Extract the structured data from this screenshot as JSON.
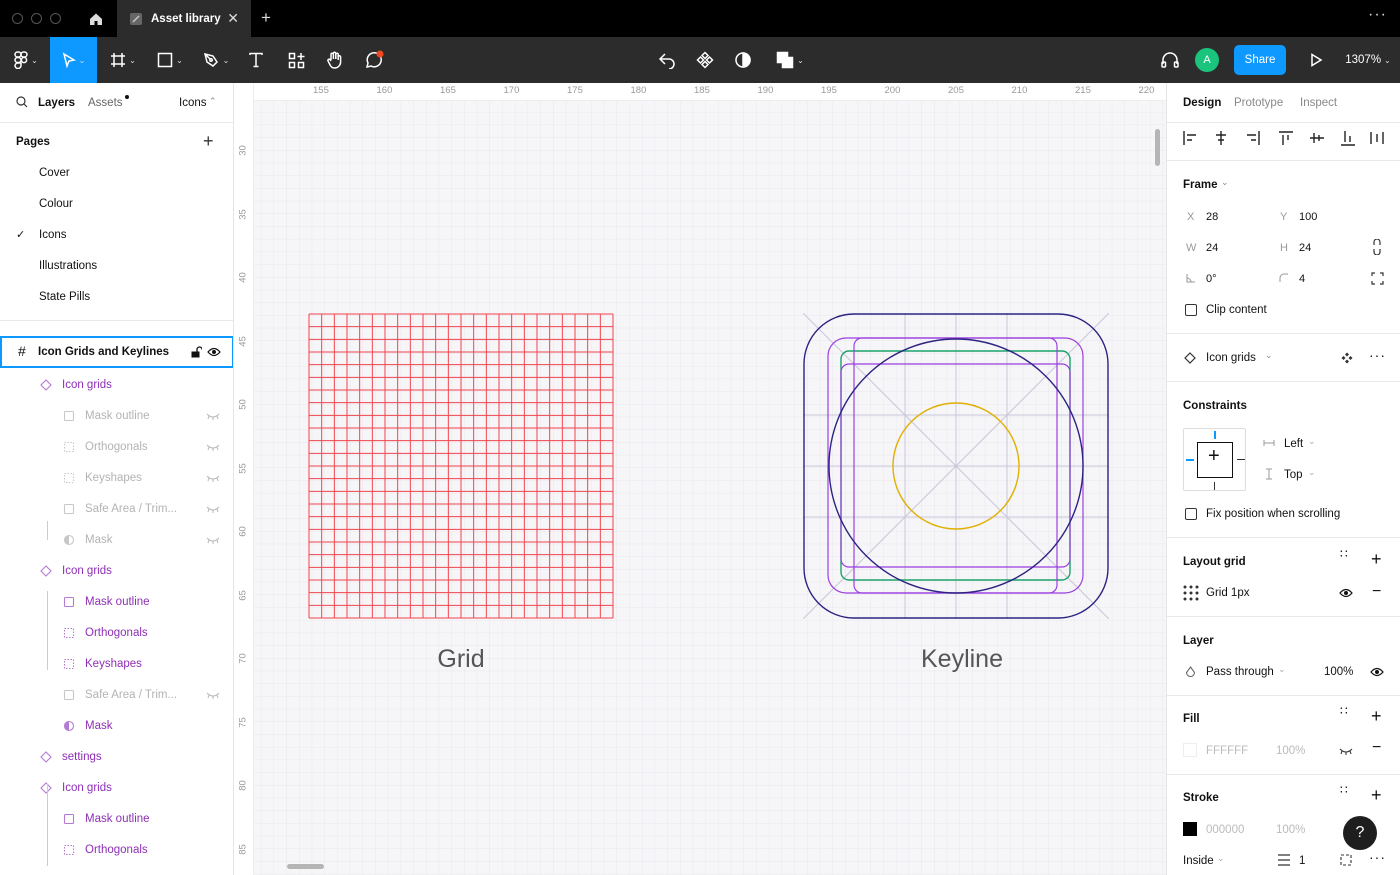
{
  "titlebar": {
    "tab_title": "Asset library"
  },
  "toolbar": {
    "share_label": "Share",
    "zoom": "1307%",
    "avatar_initial": "A"
  },
  "left": {
    "tabs": {
      "layers": "Layers",
      "assets": "Assets",
      "page_selector": "Icons"
    },
    "pages_title": "Pages",
    "pages": [
      "Cover",
      "Colour",
      "Icons",
      "Illustrations",
      "State Pills"
    ],
    "frame_name": "Icon Grids and Keylines",
    "layers": [
      {
        "label": "Icon grids",
        "style": "purple",
        "indent": 62,
        "icon": "component"
      },
      {
        "label": "Mask outline",
        "style": "grey",
        "indent": 85,
        "icon": "rect",
        "hidden": true
      },
      {
        "label": "Orthogonals",
        "style": "grey",
        "indent": 85,
        "icon": "dotted",
        "hidden": true
      },
      {
        "label": "Keyshapes",
        "style": "grey",
        "indent": 85,
        "icon": "dotted",
        "hidden": true
      },
      {
        "label": "Safe Area / Trim...",
        "style": "grey",
        "indent": 85,
        "icon": "rect",
        "hidden": true
      },
      {
        "label": "Mask",
        "style": "grey",
        "indent": 85,
        "icon": "mask",
        "hidden": true
      },
      {
        "label": "Icon grids",
        "style": "purple",
        "indent": 62,
        "icon": "component"
      },
      {
        "label": "Mask outline",
        "style": "purple",
        "indent": 85,
        "icon": "rect"
      },
      {
        "label": "Orthogonals",
        "style": "purple",
        "indent": 85,
        "icon": "dotted"
      },
      {
        "label": "Keyshapes",
        "style": "purple",
        "indent": 85,
        "icon": "dotted"
      },
      {
        "label": "Safe Area / Trim...",
        "style": "grey",
        "indent": 85,
        "icon": "rect",
        "hidden": true
      },
      {
        "label": "Mask",
        "style": "purple",
        "indent": 85,
        "icon": "mask"
      },
      {
        "label": "settings",
        "style": "purple",
        "indent": 62,
        "icon": "component"
      },
      {
        "label": "Icon grids",
        "style": "purple",
        "indent": 62,
        "icon": "component"
      },
      {
        "label": "Mask outline",
        "style": "purple",
        "indent": 85,
        "icon": "rect"
      },
      {
        "label": "Orthogonals",
        "style": "purple",
        "indent": 85,
        "icon": "dotted"
      }
    ]
  },
  "canvas": {
    "ruler_top": [
      "155",
      "160",
      "165",
      "170",
      "175",
      "180",
      "185",
      "190",
      "195",
      "200",
      "205",
      "210",
      "215",
      "220"
    ],
    "ruler_left": [
      "30",
      "35",
      "40",
      "45",
      "50",
      "55",
      "60",
      "65",
      "70",
      "75",
      "80",
      "85"
    ],
    "grid_label": "Grid",
    "keyline_label": "Keyline",
    "colors": {
      "grid_line": "#f2444e",
      "keyline_outer": "#2b2482",
      "keyline_green": "#1aa36b",
      "keyline_purple": "#9b3fe0",
      "keyline_circle_inner": "#e0b000"
    }
  },
  "right": {
    "tabs": {
      "design": "Design",
      "prototype": "Prototype",
      "inspect": "Inspect"
    },
    "frame": {
      "title": "Frame",
      "x_label": "X",
      "x": "28",
      "y_label": "Y",
      "y": "100",
      "w_label": "W",
      "w": "24",
      "h_label": "H",
      "h": "24",
      "rotation": "0°",
      "radius": "4",
      "clip_content": "Clip content"
    },
    "component": {
      "name": "Icon grids"
    },
    "constraints": {
      "title": "Constraints",
      "horizontal": "Left",
      "vertical": "Top",
      "fix_position": "Fix position when scrolling"
    },
    "layout_grid": {
      "title": "Layout grid",
      "item": "Grid 1px"
    },
    "layer": {
      "title": "Layer",
      "blend": "Pass through",
      "opacity": "100%"
    },
    "fill": {
      "title": "Fill",
      "hex": "FFFFFF",
      "opacity": "100%"
    },
    "stroke": {
      "title": "Stroke",
      "hex": "000000",
      "opacity": "100%",
      "position": "Inside",
      "weight": "1"
    }
  },
  "help": {
    "label": "?"
  }
}
